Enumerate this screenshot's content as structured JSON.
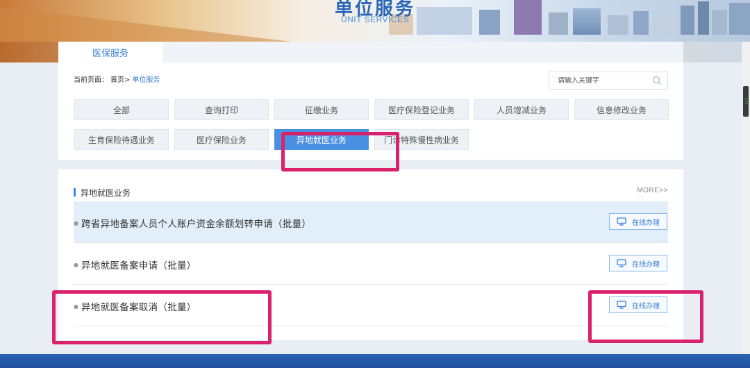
{
  "banner": {
    "title": "单位服务",
    "subtitle": "UNIT SERVICES"
  },
  "tabs": [
    {
      "label": "医保服务",
      "active": true
    }
  ],
  "breadcrumb": {
    "prefix": "当前页面：",
    "home": "首页>",
    "current": "单位服务"
  },
  "search": {
    "placeholder": "请输入关键字",
    "icon": "search-icon"
  },
  "categories": [
    {
      "label": "全部",
      "active": false
    },
    {
      "label": "查询打印",
      "active": false
    },
    {
      "label": "征缴业务",
      "active": false
    },
    {
      "label": "医疗保险登记业务",
      "active": false
    },
    {
      "label": "人员增减业务",
      "active": false
    },
    {
      "label": "信息修改业务",
      "active": false
    },
    {
      "label": "生育保险待遇业务",
      "active": false
    },
    {
      "label": "医疗保险业务",
      "active": false
    },
    {
      "label": "异地就医业务",
      "active": true
    },
    {
      "label": "门诊特殊慢性病业务",
      "active": false
    }
  ],
  "section": {
    "title": "异地就医业务",
    "more": "MORE>>"
  },
  "items": [
    {
      "title": "跨省异地备案人员个人账户资金余额划转申请（批量）",
      "button": "在线办理",
      "highlighted": true
    },
    {
      "title": "异地就医备案申请（批量）",
      "button": "在线办理",
      "highlighted": false
    },
    {
      "title": "异地就医备案取消（批量）",
      "button": "在线办理",
      "highlighted": false
    }
  ],
  "colors": {
    "accent": "#4a90e2",
    "link": "#3b7fd3",
    "annotation": "#d9226b",
    "bottom_bar": "#2c63b4"
  }
}
